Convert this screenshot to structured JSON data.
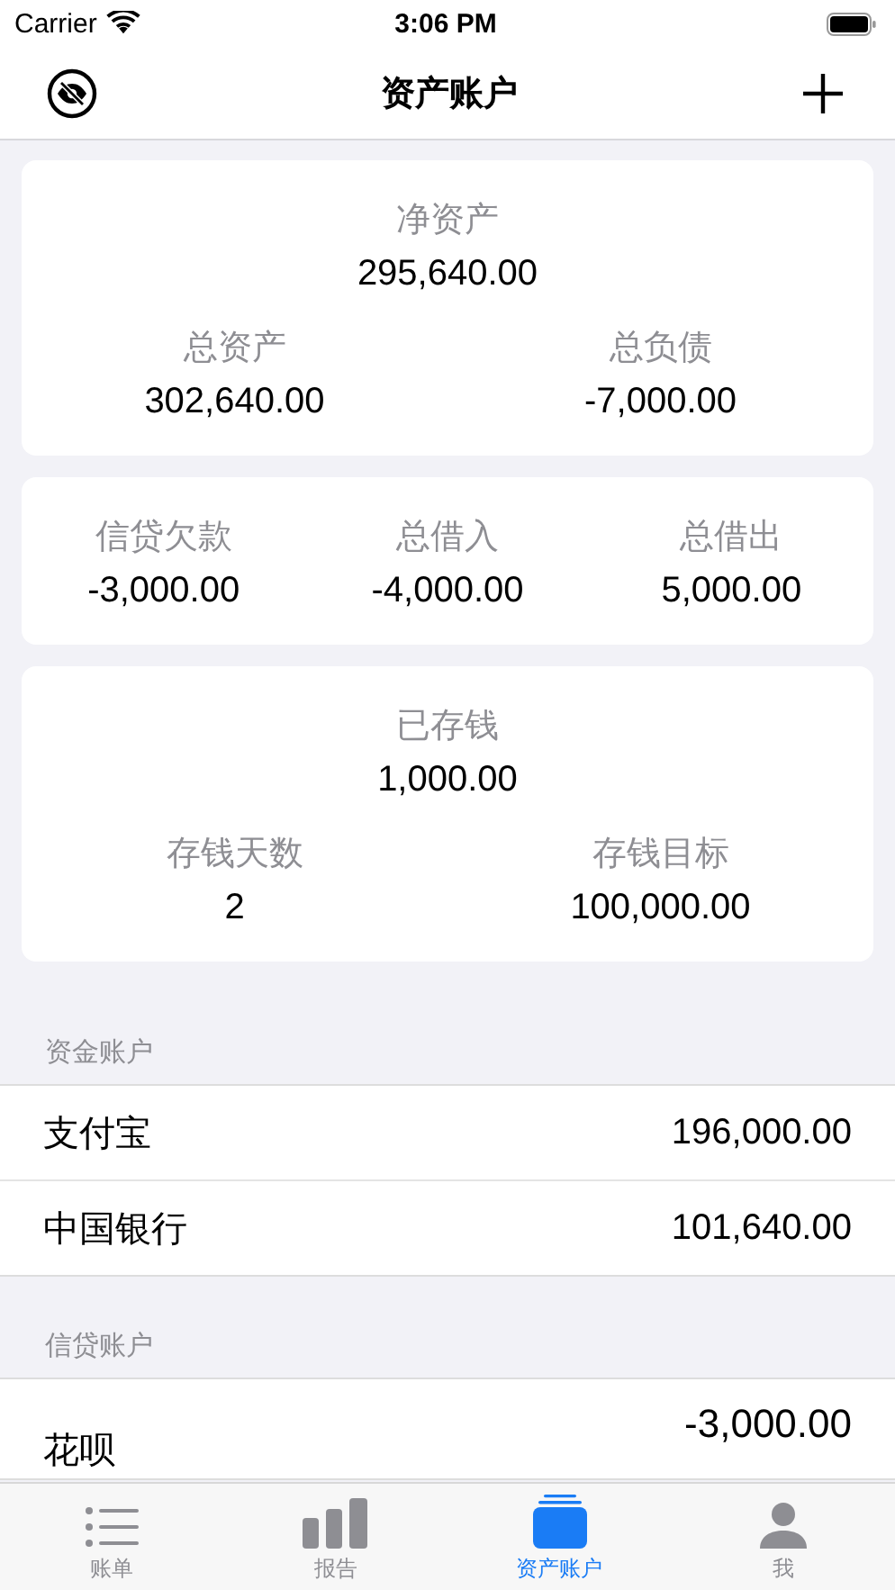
{
  "status_bar": {
    "carrier": "Carrier",
    "time": "3:06 PM"
  },
  "nav": {
    "title": "资产账户"
  },
  "summary_cards": [
    {
      "rows": [
        [
          {
            "label": "净资产",
            "value": "295,640.00"
          }
        ],
        [
          {
            "label": "总资产",
            "value": "302,640.00"
          },
          {
            "label": "总负债",
            "value": "-7,000.00"
          }
        ]
      ]
    },
    {
      "rows": [
        [
          {
            "label": "信贷欠款",
            "value": "-3,000.00"
          },
          {
            "label": "总借入",
            "value": "-4,000.00"
          },
          {
            "label": "总借出",
            "value": "5,000.00"
          }
        ]
      ]
    },
    {
      "rows": [
        [
          {
            "label": "已存钱",
            "value": "1,000.00"
          }
        ],
        [
          {
            "label": "存钱天数",
            "value": "2"
          },
          {
            "label": "存钱目标",
            "value": "100,000.00"
          }
        ]
      ]
    }
  ],
  "sections": [
    {
      "title": "资金账户",
      "accounts": [
        {
          "name": "支付宝",
          "amount": "196,000.00",
          "kind": "plain"
        },
        {
          "name": "中国银行",
          "amount": "101,640.00",
          "kind": "plain"
        }
      ]
    },
    {
      "title": "信贷账户",
      "accounts": [
        {
          "name": "花呗",
          "amount": "-3,000.00",
          "kind": "credit"
        }
      ]
    }
  ],
  "tab_bar": [
    {
      "label": "账单",
      "kind": "list",
      "selected": false
    },
    {
      "label": "报告",
      "kind": "bars",
      "selected": false
    },
    {
      "label": "资产账户",
      "kind": "cards",
      "selected": true
    },
    {
      "label": "我",
      "kind": "person",
      "selected": false
    }
  ]
}
